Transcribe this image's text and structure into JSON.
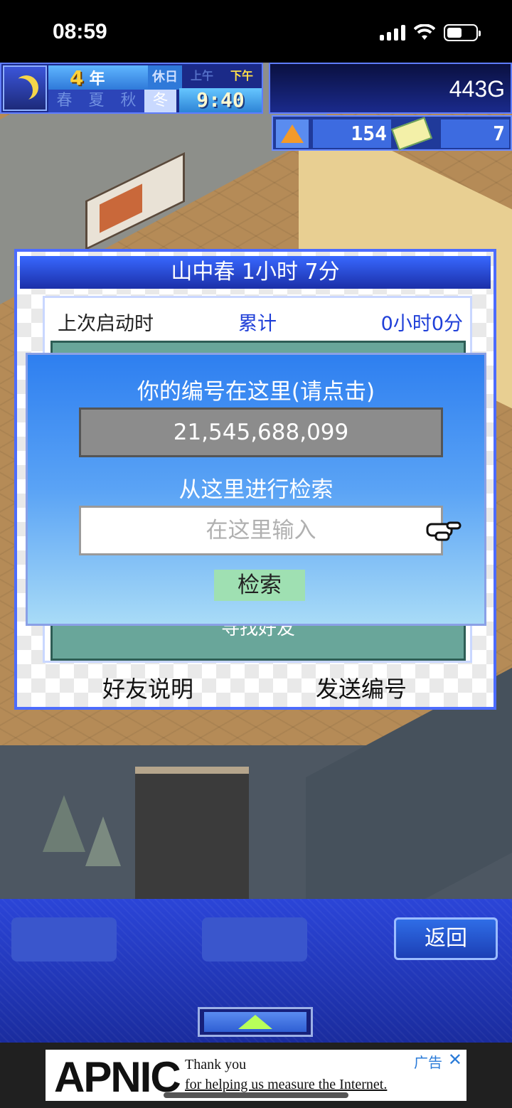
{
  "status_bar": {
    "time": "08:59"
  },
  "hud": {
    "year_number": "4",
    "year_unit": "年",
    "holiday": "休日",
    "am": "上午",
    "pm": "下午",
    "active_period": "pm",
    "clock": "9:40",
    "seasons": [
      "春",
      "夏",
      "秋",
      "冬"
    ],
    "active_season": "冬",
    "money": "443G",
    "research_points": "154",
    "tickets": "7"
  },
  "friend_panel": {
    "title": "山中春  1小时 7分",
    "last_launch_label": "上次启动时",
    "total_label": "累计",
    "total_value": "0小时0分",
    "find_friend": "寻找好友",
    "friend_help": "好友说明",
    "send_id": "发送编号"
  },
  "id_dialog": {
    "your_id_label": "你的编号在这里(请点击)",
    "id_value": "21,545,688,099",
    "search_label": "从这里进行检索",
    "search_placeholder": "在这里输入",
    "search_button": "检索"
  },
  "bottom_menu": {
    "back_button": "返回"
  },
  "ad": {
    "logo": "APNIC",
    "line1": "Thank you",
    "line2": "for helping us measure the Internet.",
    "tag": "广告",
    "close": "✕"
  }
}
